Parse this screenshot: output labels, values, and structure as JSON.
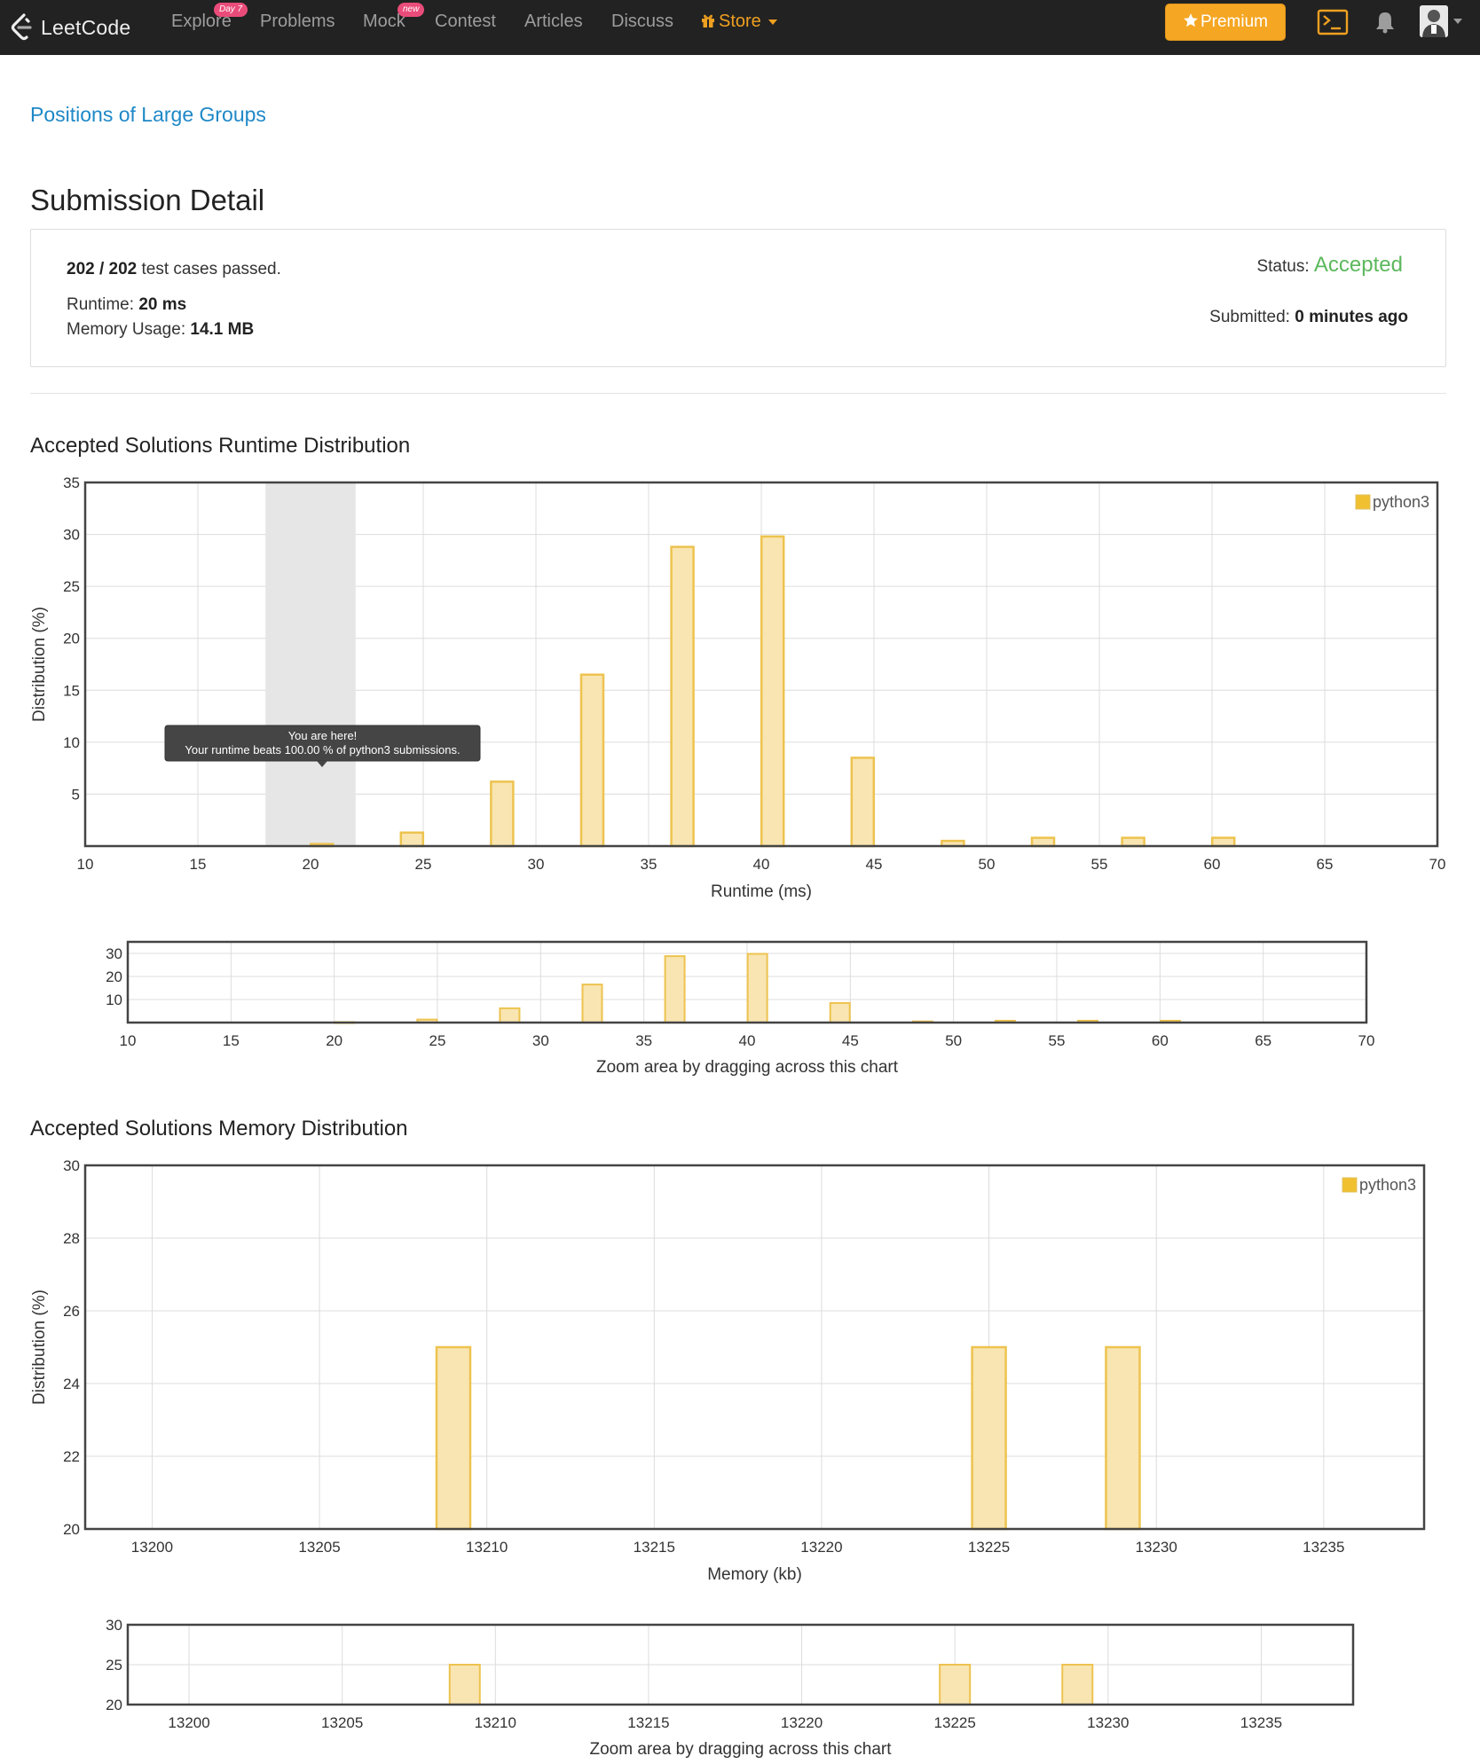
{
  "nav": {
    "logo_text": "LeetCode",
    "items": [
      {
        "label": "Explore",
        "badge": "Day 7"
      },
      {
        "label": "Problems",
        "badge": ""
      },
      {
        "label": "Mock",
        "badge": "new"
      },
      {
        "label": "Contest",
        "badge": ""
      },
      {
        "label": "Articles",
        "badge": ""
      },
      {
        "label": "Discuss",
        "badge": ""
      }
    ],
    "store_label": "Store",
    "premium_label": "Premium",
    "icons": [
      "gift-icon",
      "star-icon",
      "terminal-icon",
      "bell-icon",
      "avatar",
      "caret-down-icon"
    ]
  },
  "problem": {
    "title": "Positions of Large Groups"
  },
  "submission": {
    "heading": "Submission Detail",
    "passed": "202",
    "total": "202",
    "test_cases_text": "test cases passed.",
    "runtime_label": "Runtime:",
    "runtime_value": "20 ms",
    "memory_label": "Memory Usage:",
    "memory_value": "14.1 MB",
    "status_label": "Status:",
    "status_value": "Accepted",
    "submitted_label": "Submitted:",
    "submitted_value": "0 minutes ago"
  },
  "colors": {
    "accent": "#f0a020",
    "bar_fill": "#f9e5b1",
    "bar_stroke": "#edc34f",
    "accepted": "#5cb85c",
    "link": "#1e88c7"
  },
  "chart_data": [
    {
      "type": "bar",
      "title": "Accepted Solutions Runtime Distribution",
      "xlabel": "Runtime (ms)",
      "ylabel": "Distribution (%)",
      "xlim": [
        10,
        70
      ],
      "ylim": [
        0,
        35
      ],
      "xticks": [
        10,
        15,
        20,
        25,
        30,
        35,
        40,
        45,
        50,
        55,
        60,
        65,
        70
      ],
      "yticks": [
        5,
        10,
        15,
        20,
        25,
        30,
        35
      ],
      "grid": true,
      "legend": "top-right",
      "series": [
        {
          "name": "python3",
          "x": [
            20.5,
            24.5,
            28.5,
            32.5,
            36.5,
            40.5,
            44.5,
            48.5,
            52.5,
            56.5,
            60.5
          ],
          "values": [
            0.2,
            1.3,
            6.2,
            16.5,
            28.8,
            29.8,
            8.5,
            0.5,
            0.8,
            0.8,
            0.8
          ]
        }
      ],
      "highlight": {
        "x_from": 18,
        "x_to": 22
      },
      "tooltip": {
        "line1": "You are here!",
        "line2": "Your runtime beats 100.00 % of python3 submissions."
      },
      "overview": {
        "yticks": [
          10,
          20,
          30
        ],
        "ylim": [
          0,
          35
        ],
        "caption": "Zoom area by dragging across this chart"
      }
    },
    {
      "type": "bar",
      "title": "Accepted Solutions Memory Distribution",
      "xlabel": "Memory (kb)",
      "ylabel": "Distribution (%)",
      "xlim": [
        13198,
        13238
      ],
      "ylim": [
        20,
        30
      ],
      "xticks": [
        13200,
        13205,
        13210,
        13215,
        13220,
        13225,
        13230,
        13235
      ],
      "yticks": [
        20,
        22,
        24,
        26,
        28,
        30
      ],
      "grid": true,
      "legend": "top-right",
      "series": [
        {
          "name": "python3",
          "x": [
            13209,
            13225,
            13229
          ],
          "values": [
            25,
            25,
            25
          ]
        }
      ],
      "overview": {
        "yticks": [
          20,
          25,
          30
        ],
        "ylim": [
          20,
          30
        ],
        "caption": "Zoom area by dragging across this chart"
      }
    }
  ]
}
